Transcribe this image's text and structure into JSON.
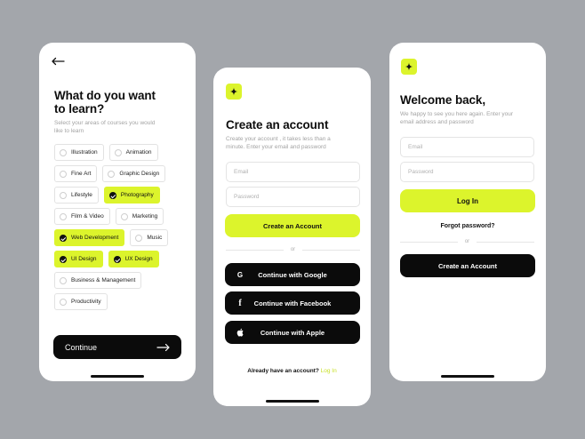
{
  "learn_screen": {
    "title_line1": "What do you want",
    "title_line2": "to learn?",
    "subtitle_line1": "Select your areas of courses you would",
    "subtitle_line2": "like to learn",
    "chips": [
      [
        {
          "label": "Illustration",
          "selected": false
        },
        {
          "label": "Animation",
          "selected": false
        }
      ],
      [
        {
          "label": "Fine Art",
          "selected": false
        },
        {
          "label": "Graphic Design",
          "selected": false
        }
      ],
      [
        {
          "label": "Lifestyle",
          "selected": false
        },
        {
          "label": "Photography",
          "selected": true
        }
      ],
      [
        {
          "label": "Film & Video",
          "selected": false
        },
        {
          "label": "Marketing",
          "selected": false
        }
      ],
      [
        {
          "label": "Web Development",
          "selected": true
        },
        {
          "label": "Music",
          "selected": false
        }
      ],
      [
        {
          "label": "UI Design",
          "selected": true
        },
        {
          "label": "UX Design",
          "selected": true
        }
      ],
      [
        {
          "label": "Business & Management",
          "selected": false
        }
      ],
      [
        {
          "label": "Productivity",
          "selected": false
        }
      ]
    ],
    "continue_label": "Continue"
  },
  "signup_screen": {
    "title": "Create an account",
    "subtitle_line1": "Create your account , it takes less than a",
    "subtitle_line2": "minute. Enter your email and password",
    "email_placeholder": "Email",
    "password_placeholder": "Password",
    "create_label": "Create an Account",
    "or_label": "or",
    "google_label": "Continue with Google",
    "facebook_label": "Continue with Facebook",
    "apple_label": "Continue with Apple",
    "footer_text": "Already have an account?",
    "footer_link": "Log In"
  },
  "login_screen": {
    "title": "Welcome back,",
    "subtitle_line1": "We happy to see you here again. Enter your",
    "subtitle_line2": "email address and password",
    "email_placeholder": "Email",
    "password_placeholder": "Password",
    "login_label": "Log In",
    "forgot_label": "Forgot password?",
    "or_label": "or",
    "create_label": "Create an Account"
  },
  "colors": {
    "accent": "#dcf42c",
    "dark": "#0b0b0b",
    "background": "#a3a6ab"
  }
}
